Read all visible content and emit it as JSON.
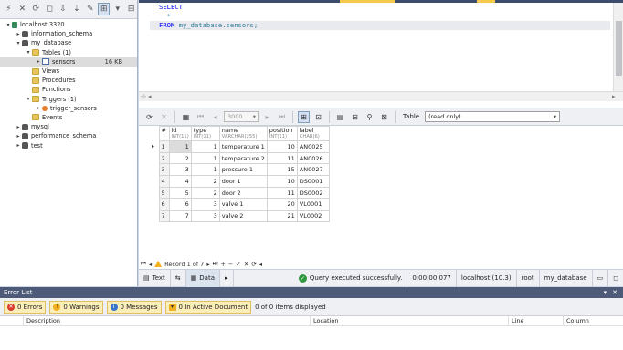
{
  "explorer": {
    "tree": [
      {
        "label": "localhost:3320",
        "level": 0,
        "twisty": "▾",
        "icon": "server-icon"
      },
      {
        "label": "information_schema",
        "level": 1,
        "twisty": "▸",
        "icon": "database-icon"
      },
      {
        "label": "my_database",
        "level": 1,
        "twisty": "▾",
        "icon": "database-icon"
      },
      {
        "label": "Tables (1)",
        "level": 2,
        "twisty": "▾",
        "icon": "folder-icon"
      },
      {
        "label": "sensors",
        "level": 3,
        "twisty": "▸",
        "icon": "table-icon",
        "size": "16 KB",
        "selected": true
      },
      {
        "label": "Views",
        "level": 2,
        "twisty": "",
        "icon": "folder-icon"
      },
      {
        "label": "Procedures",
        "level": 2,
        "twisty": "",
        "icon": "folder-icon"
      },
      {
        "label": "Functions",
        "level": 2,
        "twisty": "",
        "icon": "folder-icon"
      },
      {
        "label": "Triggers (1)",
        "level": 2,
        "twisty": "▾",
        "icon": "folder-icon"
      },
      {
        "label": "trigger_sensors",
        "level": 3,
        "twisty": "▸",
        "icon": "trigger-icon"
      },
      {
        "label": "Events",
        "level": 2,
        "twisty": "",
        "icon": "folder-icon"
      },
      {
        "label": "mysql",
        "level": 1,
        "twisty": "▸",
        "icon": "database-icon"
      },
      {
        "label": "performance_schema",
        "level": 1,
        "twisty": "▸",
        "icon": "database-icon"
      },
      {
        "label": "test",
        "level": 1,
        "twisty": "▸",
        "icon": "database-icon"
      }
    ]
  },
  "editor": {
    "lines": [
      {
        "parts": [
          {
            "t": "SELECT",
            "c": "kw"
          }
        ]
      },
      {
        "parts": [
          {
            "t": "  *",
            "c": "id"
          }
        ]
      },
      {
        "parts": [
          {
            "t": "FROM ",
            "c": "kw"
          },
          {
            "t": "my_database.sensors;",
            "c": "id"
          }
        ],
        "current": true
      }
    ]
  },
  "grid_toolbar": {
    "limit_value": "3000",
    "table_label": "Table",
    "table_mode": "(read only)"
  },
  "grid": {
    "columns": [
      {
        "name": "id",
        "type": "INT(11)"
      },
      {
        "name": "type",
        "type": "INT(11)"
      },
      {
        "name": "name",
        "type": "VARCHAR(255)"
      },
      {
        "name": "position",
        "type": "INT(11)"
      },
      {
        "name": "label",
        "type": "CHAR(6)"
      }
    ],
    "rows": [
      [
        "1",
        "1",
        "1",
        "temperature 1",
        "10",
        "AN0025"
      ],
      [
        "2",
        "2",
        "1",
        "temperature 2",
        "11",
        "AN0026"
      ],
      [
        "3",
        "3",
        "1",
        "pressure 1",
        "15",
        "AN0027"
      ],
      [
        "4",
        "4",
        "2",
        "door 1",
        "10",
        "DS0001"
      ],
      [
        "5",
        "5",
        "2",
        "door 2",
        "11",
        "DS0002"
      ],
      [
        "6",
        "6",
        "3",
        "valve 1",
        "20",
        "VL0001"
      ],
      [
        "7",
        "7",
        "3",
        "valve 2",
        "21",
        "VL0002"
      ]
    ]
  },
  "nav_bar": {
    "record_text": "Record 1 of 7"
  },
  "status_bar": {
    "text_tab": "Text",
    "data_tab": "Data",
    "message": "Query executed successfully.",
    "elapsed": "0:00:00.077",
    "connection": "localhost (10.3)",
    "user": "root",
    "database": "my_database"
  },
  "error_list": {
    "title": "Error List",
    "errors": "0 Errors",
    "warnings": "0 Warnings",
    "messages": "0 Messages",
    "active_doc": "0 In Active Document",
    "count_text": "0 of 0 items displayed",
    "headers": [
      "Description",
      "Location",
      "Line",
      "Column"
    ]
  },
  "colors": {
    "accent": "#4d5b78",
    "selection": "#dcdcdc",
    "keyword": "#0000ff",
    "identifier": "#2b7a9b",
    "ok": "#2f9a3d"
  }
}
